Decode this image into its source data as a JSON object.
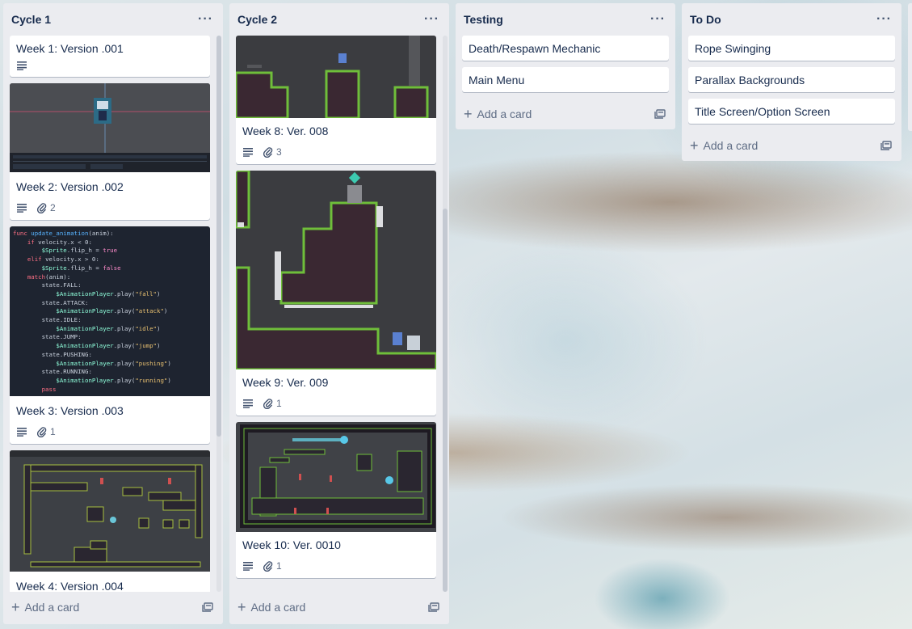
{
  "lists": [
    {
      "title": "Cycle 1",
      "add_label": "Add a card",
      "cards": [
        {
          "title": "Week 1: Version .001"
        },
        {
          "title": "Week 2: Version .002",
          "attachments": "2"
        },
        {
          "title": "Week 3: Version .003",
          "attachments": "1"
        },
        {
          "title": "Week 4: Version .004"
        }
      ]
    },
    {
      "title": "Cycle 2",
      "add_label": "Add a card",
      "cards": [
        {
          "title": "Week 8: Ver. 008",
          "attachments": "3"
        },
        {
          "title": "Week 9: Ver. 009",
          "attachments": "1"
        },
        {
          "title": "Week 10: Ver. 0010",
          "attachments": "1"
        }
      ]
    },
    {
      "title": "Testing",
      "add_label": "Add a card",
      "cards": [
        {
          "title": "Death/Respawn Mechanic"
        },
        {
          "title": "Main Menu"
        }
      ]
    },
    {
      "title": "To Do",
      "add_label": "Add a card",
      "cards": [
        {
          "title": "Rope Swinging"
        },
        {
          "title": "Parallax Backgrounds"
        },
        {
          "title": "Title Screen/Option Screen"
        }
      ]
    }
  ],
  "code_snippet": [
    "func update_animation(anim):",
    "    if velocity.x < 0:",
    "        $Sprite.flip_h = true",
    "    elif velocity.x > 0:",
    "        $Sprite.flip_h = false",
    "    match(anim):",
    "        state.FALL:",
    "            $AnimationPlayer.play(\"fall\")",
    "        state.ATTACK:",
    "            $AnimationPlayer.play(\"attack\")",
    "        state.IDLE:",
    "            $AnimationPlayer.play(\"idle\")",
    "        state.JUMP:",
    "            $AnimationPlayer.play(\"jump\")",
    "        state.PUSHING:",
    "            $AnimationPlayer.play(\"pushing\")",
    "        state.RUNNING:",
    "            $AnimationPlayer.play(\"running\")",
    "        pass"
  ],
  "icons": {
    "menu": "ellipsis-icon",
    "description": "description-icon",
    "attachment": "paperclip-icon",
    "add": "plus-icon",
    "template": "card-template-icon"
  },
  "colors": {
    "list_bg": "#ebecf0",
    "card_bg": "#ffffff",
    "text": "#172b4d",
    "muted": "#5e6c84",
    "game_green": "#6fbe3a",
    "game_dark": "#3b2a38"
  }
}
